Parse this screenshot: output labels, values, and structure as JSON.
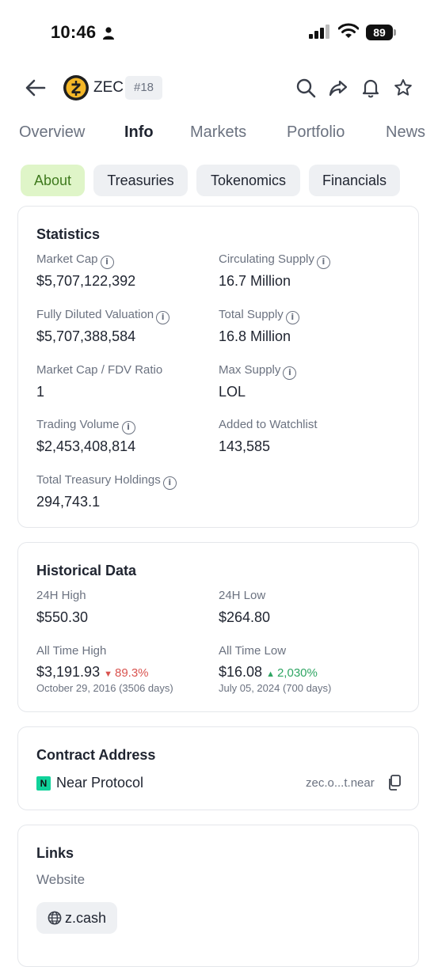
{
  "status_bar": {
    "time": "10:46",
    "battery": "89"
  },
  "header": {
    "symbol": "ZEC",
    "rank": "#18"
  },
  "tabs": [
    "Overview",
    "Info",
    "Markets",
    "Portfolio",
    "News"
  ],
  "subtabs": [
    "About",
    "Treasuries",
    "Tokenomics",
    "Financials"
  ],
  "statistics": {
    "title": "Statistics",
    "market_cap": {
      "label": "Market Cap",
      "value": "$5,707,122,392"
    },
    "circulating_supply": {
      "label": "Circulating Supply",
      "value": "16.7 Million"
    },
    "fdv": {
      "label": "Fully Diluted Valuation",
      "value": "$5,707,388,584"
    },
    "total_supply": {
      "label": "Total Supply",
      "value": "16.8 Million"
    },
    "mc_fdv_ratio": {
      "label": "Market Cap / FDV Ratio",
      "value": "1"
    },
    "max_supply": {
      "label": "Max Supply",
      "value": "LOL"
    },
    "trading_volume": {
      "label": "Trading Volume",
      "value": "$2,453,408,814"
    },
    "watchlist": {
      "label": "Added to Watchlist",
      "value": "143,585"
    },
    "treasury": {
      "label": "Total Treasury Holdings",
      "value": "294,743.1"
    }
  },
  "historical": {
    "title": "Historical Data",
    "high_24h": {
      "label": "24H High",
      "value": "$550.30"
    },
    "low_24h": {
      "label": "24H Low",
      "value": "$264.80"
    },
    "ath": {
      "label": "All Time High",
      "value": "$3,191.93",
      "change": "89.3%",
      "date": "October 29, 2016 (3506 days)"
    },
    "atl": {
      "label": "All Time Low",
      "value": "$16.08",
      "change": "2,030%",
      "date": "July 05, 2024 (700 days)"
    }
  },
  "contract": {
    "title": "Contract Address",
    "network": "Near Protocol",
    "address": "zec.o...t.near"
  },
  "links": {
    "title": "Links",
    "website_label": "Website",
    "website": "z.cash"
  },
  "colors": {
    "active_chip_bg": "#dff5c8",
    "active_chip_text": "#3f7a1e",
    "negative": "#d9534f",
    "positive": "#2fa563",
    "zec_gold": "#f4b728"
  }
}
